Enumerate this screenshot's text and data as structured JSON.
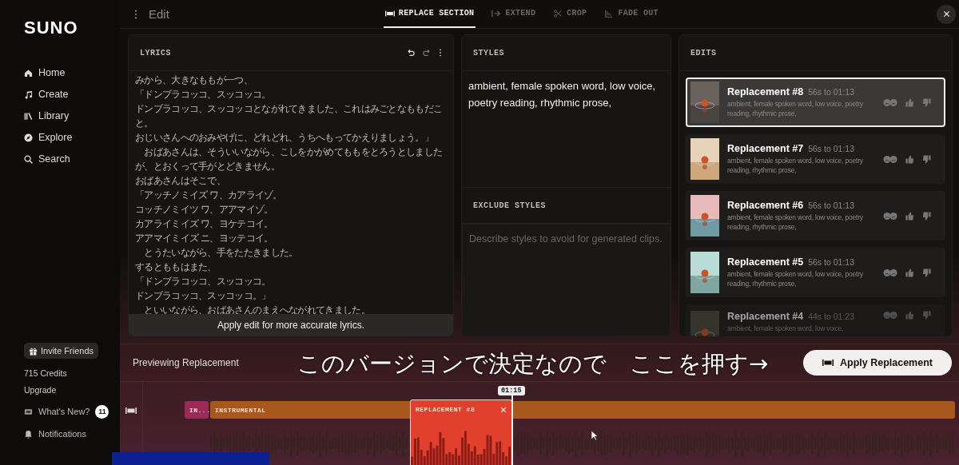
{
  "sidebar": {
    "logo": "SUNO",
    "items": [
      {
        "label": "Home",
        "selected": false
      },
      {
        "label": "Create",
        "selected": false
      },
      {
        "label": "Library",
        "selected": false
      },
      {
        "label": "Explore",
        "selected": false
      },
      {
        "label": "Search",
        "selected": false
      }
    ],
    "invite": "Invite Friends",
    "credits": "715 Credits",
    "upgrade": "Upgrade",
    "whats_new": "What's New?",
    "whats_new_count": "11",
    "notifications": "Notifications"
  },
  "topbar": {
    "title": "Edit",
    "tabs": [
      {
        "label": "REPLACE SECTION",
        "selected": true
      },
      {
        "label": "EXTEND",
        "selected": false
      },
      {
        "label": "CROP",
        "selected": false
      },
      {
        "label": "FADE OUT",
        "selected": false
      }
    ]
  },
  "lyrics": {
    "title": "LYRICS",
    "lines": [
      "みから、大きなももが一つ、",
      "「ドンブラコッコ、スッコッコ。",
      "ドンブラコッコ、スッコッコとながれてきました、これはみごとなももだこと。",
      "おじいさんへのおみやげに、どれどれ、うちへもってかえりましょう。」",
      "　おばあさんは、そういいながら、こしをかがめてももをとろうとしましたが、とおくって手がとどきません。",
      "おばあさんはそこで、",
      "「アッチノミイズ ワ、カアライゾ。",
      "コッチノミイツ ワ、アアマイゾ。",
      "カアライミイズ ワ、ヨケテコイ。",
      "アアマイミイズ ニ、ヨッテコイ。",
      "　とうたいながら、手をたたきました。",
      "するとももはまた、",
      "「ドンブラコッコ、スッコッコ。",
      "ドンブラコッコ、スッコッコ。」",
      "　といいながら、おばあさんのまえへながれてきました。"
    ],
    "notice": "Apply edit for more accurate lyrics."
  },
  "styles": {
    "title": "STYLES",
    "value": "ambient, female spoken word, low voice, poetry reading, rhythmic prose,",
    "exclude_title": "EXCLUDE STYLES",
    "exclude_placeholder": "Describe styles to avoid for generated clips."
  },
  "edits": {
    "title": "EDITS",
    "items": [
      {
        "name": "Replacement #8",
        "range": "56s to 01:13",
        "styles": "ambient, female spoken word, low voice, poetry reading, rhythmic prose,",
        "selected": true,
        "faded": false
      },
      {
        "name": "Replacement #7",
        "range": "56s to 01:13",
        "styles": "ambient, female spoken word, low voice, poetry reading, rhythmic prose,",
        "selected": false,
        "faded": false
      },
      {
        "name": "Replacement #6",
        "range": "56s to 01:13",
        "styles": "ambient, female spoken word, low voice, poetry reading, rhythmic prose,",
        "selected": false,
        "faded": false
      },
      {
        "name": "Replacement #5",
        "range": "56s to 01:13",
        "styles": "ambient, female spoken word, low voice, poetry reading, rhythmic prose,",
        "selected": false,
        "faded": false
      },
      {
        "name": "Replacement #4",
        "range": "44s to 01:23",
        "styles": "ambient, female spoken word, low voice,",
        "selected": false,
        "faded": true
      }
    ]
  },
  "preview": {
    "label": "Previewing Replacement",
    "apply": "Apply Replacement",
    "caption": "このバージョンで決定なので　ここを押す→"
  },
  "timeline": {
    "time": "01:15",
    "segments": [
      {
        "label": "IN...",
        "kind": "intro"
      },
      {
        "label": "INSTRUMENTAL",
        "kind": "instrumental"
      },
      {
        "label": "REPLACEMENT #8",
        "kind": "replacement"
      }
    ]
  }
}
